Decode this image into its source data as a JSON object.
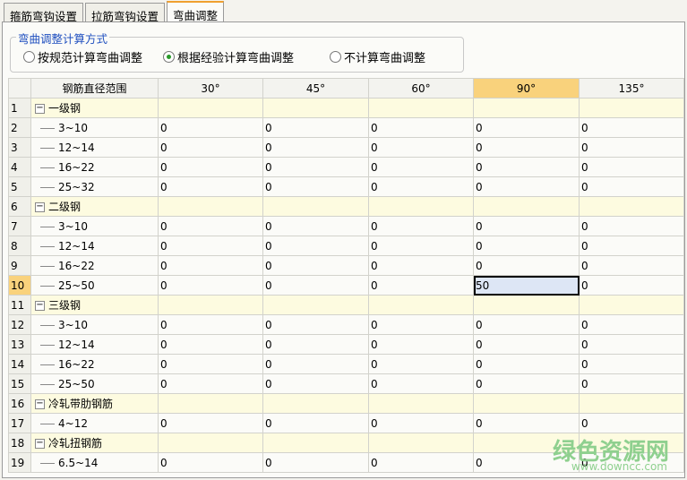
{
  "tabs": [
    "箍筋弯钩设置",
    "拉筋弯钩设置",
    "弯曲调整"
  ],
  "group": {
    "title": "弯曲调整计算方式",
    "options": [
      "按规范计算弯曲调整",
      "根据经验计算弯曲调整",
      "不计算弯曲调整"
    ],
    "selected": 1
  },
  "grid": {
    "headers": [
      "",
      "钢筋直径范围",
      "30°",
      "45°",
      "60°",
      "90°",
      "135°"
    ],
    "rows": [
      {
        "n": "1",
        "name": "一级钢",
        "group": true
      },
      {
        "n": "2",
        "name": "3~10",
        "v": [
          "0",
          "0",
          "0",
          "0",
          "0"
        ]
      },
      {
        "n": "3",
        "name": "12~14",
        "v": [
          "0",
          "0",
          "0",
          "0",
          "0"
        ]
      },
      {
        "n": "4",
        "name": "16~22",
        "v": [
          "0",
          "0",
          "0",
          "0",
          "0"
        ]
      },
      {
        "n": "5",
        "name": "25~32",
        "v": [
          "0",
          "0",
          "0",
          "0",
          "0"
        ]
      },
      {
        "n": "6",
        "name": "二级钢",
        "group": true
      },
      {
        "n": "7",
        "name": "3~10",
        "v": [
          "0",
          "0",
          "0",
          "0",
          "0"
        ]
      },
      {
        "n": "8",
        "name": "12~14",
        "v": [
          "0",
          "0",
          "0",
          "0",
          "0"
        ]
      },
      {
        "n": "9",
        "name": "16~22",
        "v": [
          "0",
          "0",
          "0",
          "0",
          "0"
        ]
      },
      {
        "n": "10",
        "name": "25~50",
        "v": [
          "0",
          "0",
          "0",
          "50",
          "0"
        ],
        "selected": 3
      },
      {
        "n": "11",
        "name": "三级钢",
        "group": true
      },
      {
        "n": "12",
        "name": "3~10",
        "v": [
          "0",
          "0",
          "0",
          "0",
          "0"
        ]
      },
      {
        "n": "13",
        "name": "12~14",
        "v": [
          "0",
          "0",
          "0",
          "0",
          "0"
        ]
      },
      {
        "n": "14",
        "name": "16~22",
        "v": [
          "0",
          "0",
          "0",
          "0",
          "0"
        ]
      },
      {
        "n": "15",
        "name": "25~50",
        "v": [
          "0",
          "0",
          "0",
          "0",
          "0"
        ]
      },
      {
        "n": "16",
        "name": "冷轧带肋钢筋",
        "group": true
      },
      {
        "n": "17",
        "name": "4~12",
        "v": [
          "0",
          "0",
          "0",
          "0",
          "0"
        ]
      },
      {
        "n": "18",
        "name": "冷轧扭钢筋",
        "group": true
      },
      {
        "n": "19",
        "name": "6.5~14",
        "v": [
          "0",
          "0",
          "0",
          "0",
          "0"
        ]
      }
    ]
  },
  "watermark": {
    "name": "绿色资源网",
    "url": "www.downcc.com"
  }
}
